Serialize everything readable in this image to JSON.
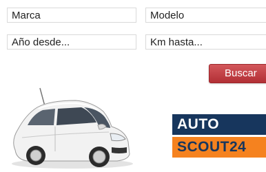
{
  "search_form": {
    "marca": "Marca",
    "modelo": "Modelo",
    "anio_desde": "Año desde...",
    "km_hasta": "Km hasta...",
    "buscar_label": "Buscar"
  },
  "logo": {
    "line1": "AUTO",
    "line2": "SCOUT24"
  },
  "colors": {
    "button": "#c0393e",
    "logo_navy": "#17365d",
    "logo_orange": "#f5821f"
  }
}
